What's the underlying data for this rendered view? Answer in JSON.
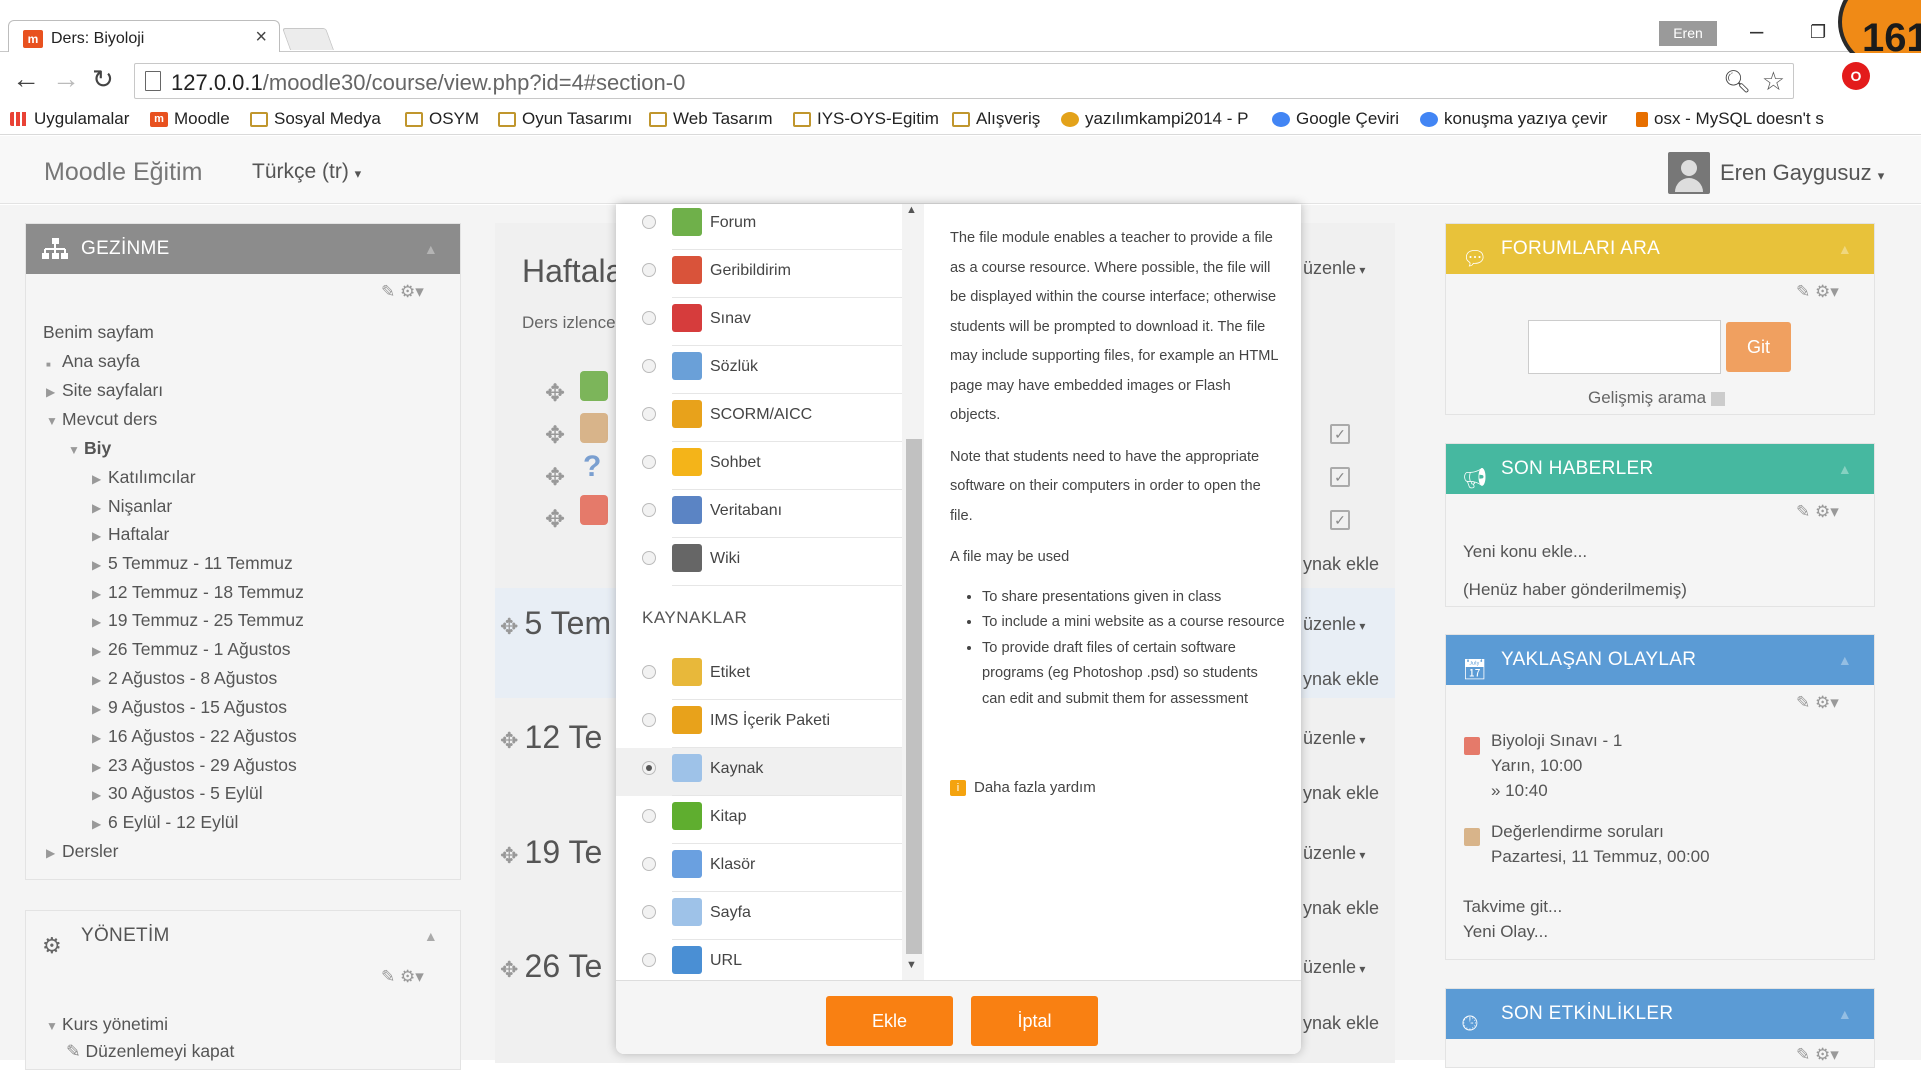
{
  "browser": {
    "tab_title": "Ders: Biyoloji",
    "tab_close": "×",
    "user_badge": "Eren",
    "counter": "161",
    "url_host": "127.0.0.1",
    "url_path": "/moodle30/course/view.php?id=4#section-0"
  },
  "bookmarks": [
    {
      "label": "Uygulamalar",
      "icon": "apps-icon"
    },
    {
      "label": "Moodle",
      "icon": "moodle-icon"
    },
    {
      "label": "Sosyal Medya",
      "icon": "folder-icon"
    },
    {
      "label": "OSYM",
      "icon": "folder-icon"
    },
    {
      "label": "Oyun Tasarımı",
      "icon": "folder-icon"
    },
    {
      "label": "Web Tasarım",
      "icon": "folder-icon"
    },
    {
      "label": "IYS-OYS-Egitim",
      "icon": "folder-icon"
    },
    {
      "label": "Alışveriş",
      "icon": "folder-icon"
    },
    {
      "label": "yazılımkampi2014 - P",
      "icon": "bird-icon"
    },
    {
      "label": "Google Çeviri",
      "icon": "translate-icon"
    },
    {
      "label": "konuşma yazıya çevir",
      "icon": "chrome-icon"
    },
    {
      "label": "osx - MySQL doesn't s",
      "icon": "java-icon"
    }
  ],
  "navbar": {
    "brand": "Moodle Eğitim",
    "language": "Türkçe (tr)",
    "user": "Eren Gaygusuz"
  },
  "nav_block": {
    "title": "GEZİNME",
    "items": [
      {
        "label": "Benim sayfam"
      },
      {
        "label": "Ana sayfa"
      },
      {
        "label": "Site sayfaları"
      },
      {
        "label": "Mevcut ders"
      },
      {
        "label": "Biy"
      },
      {
        "label": "Katılımcılar"
      },
      {
        "label": "Nişanlar"
      },
      {
        "label": "Haftalar"
      },
      {
        "label": "5 Temmuz - 11 Temmuz"
      },
      {
        "label": "12 Temmuz - 18 Temmuz"
      },
      {
        "label": "19 Temmuz - 25 Temmuz"
      },
      {
        "label": "26 Temmuz - 1 Ağustos"
      },
      {
        "label": "2 Ağustos - 8 Ağustos"
      },
      {
        "label": "9 Ağustos - 15 Ağustos"
      },
      {
        "label": "16 Ağustos - 22 Ağustos"
      },
      {
        "label": "23 Ağustos - 29 Ağustos"
      },
      {
        "label": "30 Ağustos - 5 Eylül"
      },
      {
        "label": "6 Eylül - 12 Eylül"
      },
      {
        "label": "Dersler"
      }
    ]
  },
  "admin_block": {
    "title": "YÖNETİM",
    "items": [
      {
        "label": "Kurs yönetimi"
      },
      {
        "label": "Düzenlemeyi kapat"
      }
    ]
  },
  "course": {
    "heading": "Haftala",
    "desc": "Ders izlence",
    "sections": [
      "5 Tem",
      "12 Te",
      "19 Te",
      "26 Te"
    ],
    "edit_label": "üzenle",
    "add_label": "ynak ekle"
  },
  "chooser": {
    "activities": [
      {
        "label": "Forum",
        "icon": "forum-icon",
        "color": "#6fb04a"
      },
      {
        "label": "Geribildirim",
        "icon": "megaphone-icon",
        "color": "#d9533a"
      },
      {
        "label": "Sınav",
        "icon": "quiz-check-icon",
        "color": "#d63c3c"
      },
      {
        "label": "Sözlük",
        "icon": "glossary-icon",
        "color": "#6aa0d8"
      },
      {
        "label": "SCORM/AICC",
        "icon": "scorm-package-icon",
        "color": "#e8a21b"
      },
      {
        "label": "Sohbet",
        "icon": "chat-icon",
        "color": "#f4b419"
      },
      {
        "label": "Veritabanı",
        "icon": "database-icon",
        "color": "#5b84c4"
      },
      {
        "label": "Wiki",
        "icon": "wiki-icon",
        "color": "#666666"
      }
    ],
    "resources_heading": "KAYNAKLAR",
    "resources": [
      {
        "label": "Etiket",
        "icon": "label-tag-icon",
        "color": "#e8b83a"
      },
      {
        "label": "IMS İçerik Paketi",
        "icon": "ims-package-icon",
        "color": "#e8a21b"
      },
      {
        "label": "Kaynak",
        "icon": "file-icon",
        "color": "#9ec2e8",
        "selected": true
      },
      {
        "label": "Kitap",
        "icon": "book-icon",
        "color": "#5fae2f"
      },
      {
        "label": "Klasör",
        "icon": "folder-icon",
        "color": "#6aa0e0"
      },
      {
        "label": "Sayfa",
        "icon": "page-icon",
        "color": "#9ec2e8"
      },
      {
        "label": "URL",
        "icon": "globe-link-icon",
        "color": "#4a8fd4"
      }
    ],
    "help": {
      "p1": "The file module enables a teacher to provide a file as a course resource. Where possible, the file will be displayed within the course interface; otherwise students will be prompted to download it. The file may include supporting files, for example an HTML page may have embedded images or Flash objects.",
      "p2": "Note that students need to have the appropriate software on their computers in order to open the file.",
      "p3": "A file may be used",
      "bullets": [
        "To share presentations given in class",
        "To include a mini website as a course resource",
        "To provide draft files of certain software programs (eg Photoshop .psd) so students can edit and submit them for assessment"
      ],
      "more": "Daha fazla yardım"
    },
    "add_button": "Ekle",
    "cancel_button": "İptal"
  },
  "forum_search": {
    "title": "FORUMLARI ARA",
    "go": "Git",
    "advanced": "Gelişmiş arama"
  },
  "news": {
    "title": "SON HABERLER",
    "add": "Yeni konu ekle...",
    "empty": "(Henüz haber gönderilmemiş)"
  },
  "events": {
    "title": "YAKLAŞAN OLAYLAR",
    "items": [
      {
        "name": "Biyoloji Sınavı - 1",
        "when": "Yarın, 10:00",
        "until": "» 10:40"
      },
      {
        "name": "Değerlendirme soruları",
        "when": "Pazartesi, 11 Temmuz, 00:00"
      }
    ],
    "calendar": "Takvime git...",
    "new_event": "Yeni Olay..."
  },
  "recent": {
    "title": "SON ETKİNLİKLER"
  },
  "colors": {
    "accent": "#f98012",
    "forum_block": "#e8c23a",
    "news_block": "#46b8a0",
    "events_block": "#5b9bd5",
    "recent_block": "#5b9bd5",
    "nav_block": "#8c8c8c"
  }
}
